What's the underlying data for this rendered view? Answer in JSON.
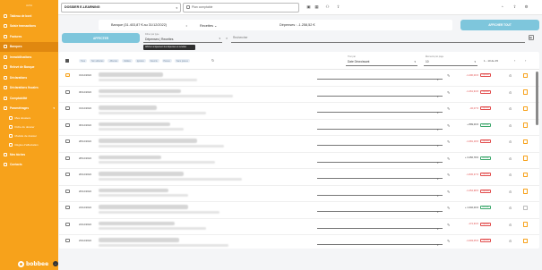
{
  "sidebar": {
    "top_label": "AV01",
    "items": [
      {
        "label": "Tableau de bord"
      },
      {
        "label": "Saisie transactions"
      },
      {
        "label": "Factures"
      },
      {
        "label": "Banques"
      },
      {
        "label": "Immobilisations"
      },
      {
        "label": "Relevé de Banque"
      },
      {
        "label": "Déclarations"
      },
      {
        "label": "Déclarations fiscales"
      },
      {
        "label": "Comptabilité"
      },
      {
        "label": "Paramétrages"
      }
    ],
    "sub_items": [
      {
        "label": "Mes dossiers"
      },
      {
        "label": "Fiche du dossier"
      },
      {
        "label": "Modèle de dossier"
      },
      {
        "label": "Règles d'affectation"
      }
    ],
    "more_items": [
      {
        "label": "Mes tâches"
      },
      {
        "label": "Contacts"
      }
    ],
    "brand": "bobbee",
    "collapse_glyph": "‹"
  },
  "topbar": {
    "dossier": "DOSSIER E-LEARNING",
    "dossier_caret": "▾",
    "plan_comptable_placeholder": "Plan comptable",
    "avatar_initials": "MD",
    "icons": {
      "doc": "▣",
      "grid": "▦",
      "user": "⚇",
      "upload": "⇪",
      "bell": "◔",
      "gear": "⚙"
    }
  },
  "summary": {
    "banque": "Banque (31.403,87 € au 31/12/2022)",
    "sep": "◂",
    "recettes": "Recettes ⌄",
    "depenses": "Dépenses : -1.258,52 €"
  },
  "buttons": {
    "affecter": "AFFECTER",
    "orange": "AFFICHER TOUT"
  },
  "filters": {
    "type_label": "Filtrer par type",
    "type_value": "Dépenses | Recettes",
    "type_caret": "▾",
    "tooltip": "Afficher uniquement les dépenses et recettes",
    "search_icon": "⌕",
    "search_placeholder": "Rechercher",
    "calendar_glyph": "▤"
  },
  "table": {
    "chips": [
      "Tous",
      "Non affectés",
      "Affectés",
      "Validés",
      "Ignorés",
      "Favoris",
      "Pièces",
      "Sans pièces"
    ],
    "refresh": "↻",
    "sort_label": "Trier par",
    "sort_value": "Date Décroissant",
    "sort_caret": "▾",
    "per_page_label": "Éléments par page",
    "per_page_value": "10",
    "per_page_caret": "▾",
    "pager": "1 - 10 de 45",
    "prev": "‹",
    "next": "›",
    "pencil_glyph": "✎",
    "action_glyph": "⊙",
    "rows": [
      {
        "date": "31/12/2022",
        "amount": "-1.200,00 €",
        "sign": "neg",
        "badge": "Dépense",
        "w1": 72,
        "w2": 110
      },
      {
        "date": "30/12/2022",
        "amount": "-1.261,94 €",
        "sign": "neg",
        "badge": "Dépense",
        "w1": 92,
        "w2": 150
      },
      {
        "date": "31/12/2022",
        "amount": "-32,07 €",
        "sign": "neg",
        "badge": "Dépense",
        "w1": 65,
        "w2": 120
      },
      {
        "date": "30/12/2022",
        "amount": "+ 899,00 €",
        "sign": "pos",
        "badge": "Recette",
        "w1": 80,
        "w2": 95
      },
      {
        "date": "28/12/2022",
        "amount": "-1.081,18 €",
        "sign": "neg",
        "badge": "Dépense",
        "w1": 110,
        "w2": 140
      },
      {
        "date": "28/12/2022",
        "amount": "+ 3.456,78 €",
        "sign": "pos",
        "badge": "Recette",
        "w1": 70,
        "w2": 130
      },
      {
        "date": "26/12/2022",
        "amount": "-1.845,37 €",
        "sign": "neg",
        "badge": "Dépense",
        "w1": 95,
        "w2": 160
      },
      {
        "date": "26/12/2022",
        "amount": "-1.254,98 €",
        "sign": "neg",
        "badge": "Dépense",
        "w1": 78,
        "w2": 100
      },
      {
        "date": "24/12/2022",
        "amount": "+ 1.002,00 €",
        "sign": "pos",
        "badge": "Recette",
        "w1": 100,
        "w2": 135
      },
      {
        "date": "24/12/2022",
        "amount": "-174,93 €",
        "sign": "neg",
        "badge": "Dépense",
        "w1": 85,
        "w2": 120
      },
      {
        "date": "23/12/2022",
        "amount": "-1.093,05 €",
        "sign": "neg",
        "badge": "Dépense",
        "w1": 90,
        "w2": 145
      }
    ]
  }
}
